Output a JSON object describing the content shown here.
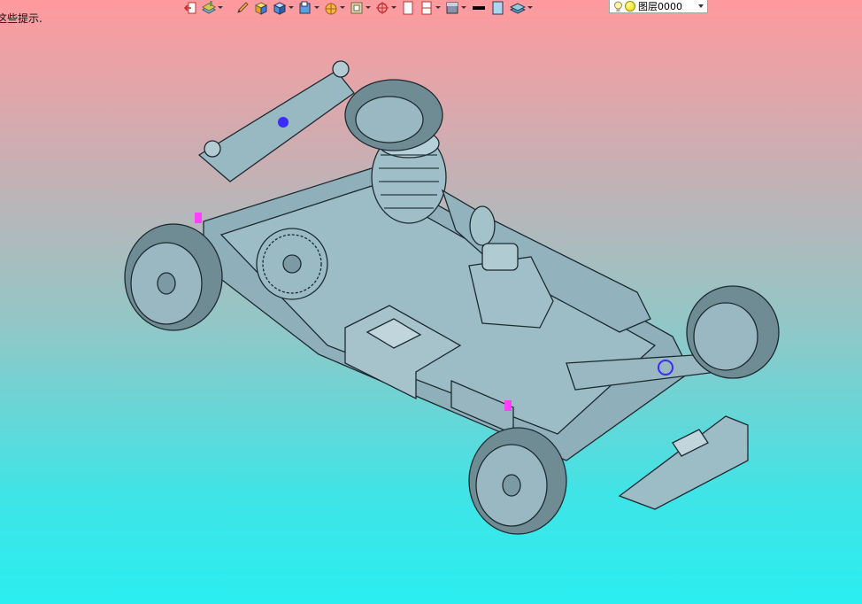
{
  "hint_text": "这些提示.",
  "layer": {
    "name": "图层0000"
  },
  "colors": {
    "model_fill": "#8fb3bd",
    "model_stroke": "#1d2a30",
    "tire": "#6f8c94",
    "accent_blue": "#3a2cff",
    "accent_magenta": "#ff40ff",
    "swatch_black": "#000000",
    "swatch_light": "#a9d8f0"
  },
  "icons": [
    "return-icon",
    "layer-paint-icon",
    "pencil-icon",
    "cube-yellow-icon",
    "cube-blue-icon",
    "cube-dropdown-icon",
    "sphere-icon",
    "frame-icon",
    "target-icon",
    "page-icon",
    "page-split-icon",
    "shade-icon",
    "color-black-swatch",
    "color-light-swatch",
    "layers-icon"
  ]
}
